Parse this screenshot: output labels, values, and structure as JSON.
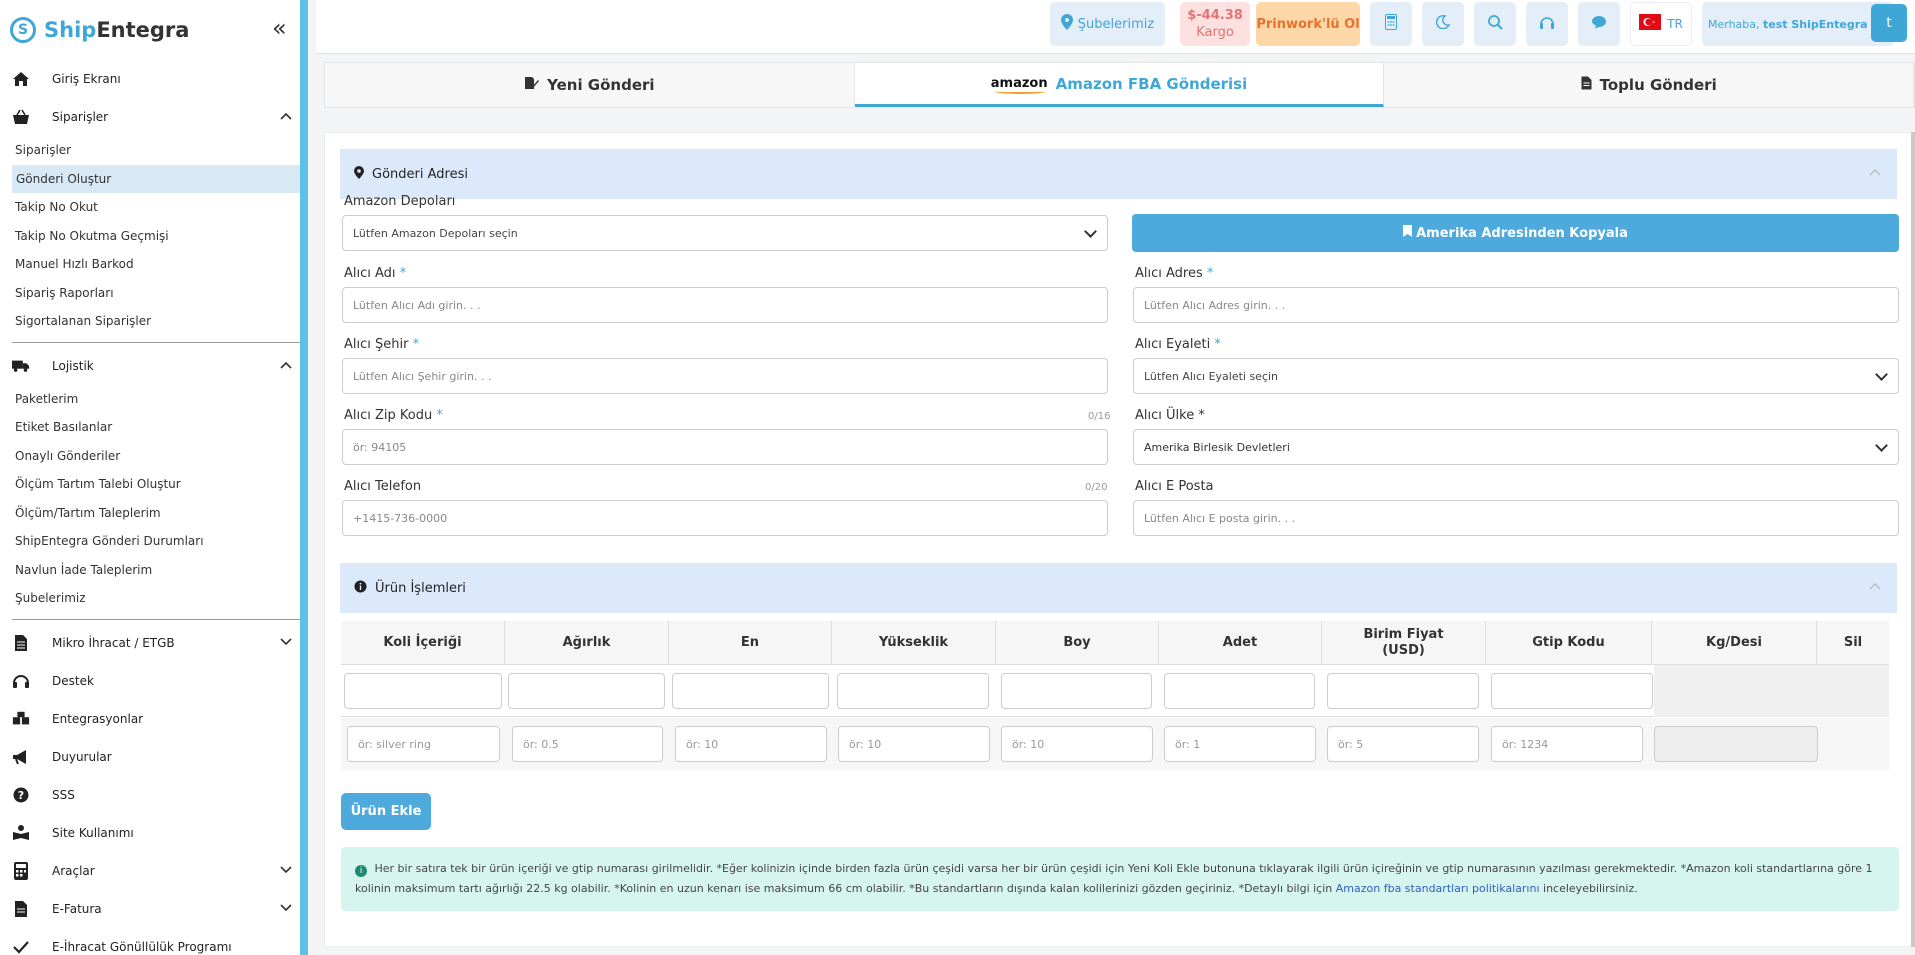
{
  "brand": {
    "part1": "Ship",
    "part2": "Entegra",
    "collapse": "«"
  },
  "sidebar": {
    "home": "Giriş Ekranı",
    "orders": {
      "label": "Siparişler",
      "items": [
        "Siparişler",
        "Gönderi Oluştur",
        "Takip No Okut",
        "Takip No Okutma Geçmişi",
        "Manuel Hızlı Barkod",
        "Sipariş Raporları",
        "Sigortalanan Siparişler"
      ]
    },
    "logistics": {
      "label": "Lojistik",
      "items": [
        "Paketlerim",
        "Etiket Basılanlar",
        "Onaylı Gönderiler",
        "Ölçüm Tartım Talebi Oluştur",
        "Ölçüm/Tartım Taleplerim",
        "ShipEntegra Gönderi Durumları",
        "Navlun İade Taleplerim",
        "Şubelerimiz"
      ]
    },
    "micro_export": "Mikro İhracat / ETGB",
    "support": "Destek",
    "integrations": "Entegrasyonlar",
    "announcements": "Duyurular",
    "faq": "SSS",
    "site_usage": "Site Kullanımı",
    "tools": "Araçlar",
    "einvoice": "E-Fatura",
    "volunteer": "E-İhracat Gönüllülük Programı"
  },
  "topbar": {
    "branches": "Şubelerimiz",
    "balance": "$-44.38",
    "balance_sub": "Kargo",
    "prinwork": "Prinwork'lü Ol",
    "lang": "TR",
    "greeting": "Merhaba,",
    "user": "test ShipEntegra",
    "avatar": "t"
  },
  "tabs": {
    "new_shipment": "Yeni Gönderi",
    "amazon_logo": "amazon",
    "amazon_fba": "Amazon FBA Gönderisi",
    "bulk": "Toplu Gönderi"
  },
  "address_section": {
    "title": "Gönderi Adresi",
    "amazon_depots_label": "Amazon Depoları",
    "amazon_depots_value": "Lütfen Amazon Depoları seçin",
    "copy_button": "Amerika Adresinden Kopyala",
    "name_label": "Alıcı Adı",
    "name_placeholder": "Lütfen Alıcı Adı girin. . .",
    "address_label": "Alıcı Adres",
    "address_placeholder": "Lütfen Alıcı Adres girin. . .",
    "city_label": "Alıcı Şehir",
    "city_placeholder": "Lütfen Alıcı Şehir girin. . .",
    "state_label": "Alıcı Eyaleti",
    "state_value": "Lütfen Alıcı Eyaleti seçin",
    "zip_label": "Alıcı Zip Kodu",
    "zip_counter": "0/16",
    "zip_placeholder": "ör: 94105",
    "country_label": "Alıcı Ülke *",
    "country_value": "Amerika Birlesik Devletleri",
    "phone_label": "Alıcı Telefon",
    "phone_counter": "0/20",
    "phone_placeholder": "+1415-736-0000",
    "email_label": "Alıcı E Posta",
    "email_placeholder": "Lütfen Alıcı E posta girin. . .",
    "required_mark": "*"
  },
  "product_section": {
    "title": "Ürün İşlemleri",
    "columns": [
      "Koli İçeriği",
      "Ağırlık",
      "En",
      "Yükseklik",
      "Boy",
      "Adet",
      "Birim Fiyat (USD)",
      "Gtip Kodu",
      "Kg/Desi",
      "Sil"
    ],
    "placeholders": [
      "ör: silver ring",
      "ör: 0.5",
      "ör: 10",
      "ör: 10",
      "ör: 10",
      "ör: 1",
      "ör: 5",
      "ör: 1234"
    ],
    "add_button": "Ürün Ekle"
  },
  "info": {
    "text": "Her bir satıra tek bir ürün içeriği ve gtip numarası girilmelidir. *Eğer kolinizin içinde birden fazla ürün çeşidi varsa her bir ürün çeşidi için Yeni Koli Ekle butonuna tıklayarak ilgili ürün içireğinin ve gtip numarasının yazılması gerekmektedir. *Amazon koli standartlarına göre 1 kolinin maksimum tartı ağırlığı 22.5 kg olabilir. *Kolinin en uzun kenarı ise maksimum 66 cm olabilir. *Bu standartların dışında kalan kolilerinizi gözden geçiriniz. *Detaylı bilgi için",
    "link": "Amazon fba standartları politikalarını",
    "suffix": "inceleyebilirsiniz."
  },
  "colors": {
    "accent": "#3fa7d6",
    "sidebar_border": "#5bc1e6",
    "section_bg": "#dce9fb",
    "info_bg": "#d6f5ef"
  }
}
